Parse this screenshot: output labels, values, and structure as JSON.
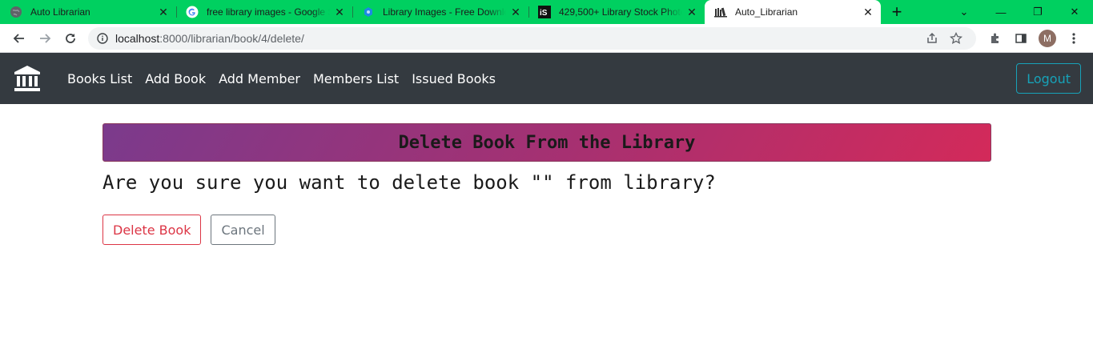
{
  "browser": {
    "tabs": [
      {
        "title": "Auto Librarian",
        "icon": "globe-icon"
      },
      {
        "title": "free library images - Google Search",
        "icon": "google-icon"
      },
      {
        "title": "Library Images - Free Download",
        "icon": "pixabay-icon"
      },
      {
        "title": "429,500+ Library Stock Photos",
        "icon": "istock-icon"
      },
      {
        "title": "Auto_Librarian",
        "icon": "books-icon"
      }
    ],
    "url_host": "localhost",
    "url_rest": ":8000/librarian/book/4/delete/",
    "avatar_letter": "M"
  },
  "navbar": {
    "links": [
      "Books List",
      "Add Book",
      "Add Member",
      "Members List",
      "Issued Books"
    ],
    "logout_label": "Logout"
  },
  "page": {
    "heading": "Delete Book From the Library",
    "question": "Are you sure you want to delete book \"\" from library?",
    "delete_label": "Delete Book",
    "cancel_label": "Cancel"
  },
  "colors": {
    "tabstrip": "#00d060",
    "navbar": "#343a40",
    "danger": "#dc3545",
    "info": "#17a2b8"
  }
}
